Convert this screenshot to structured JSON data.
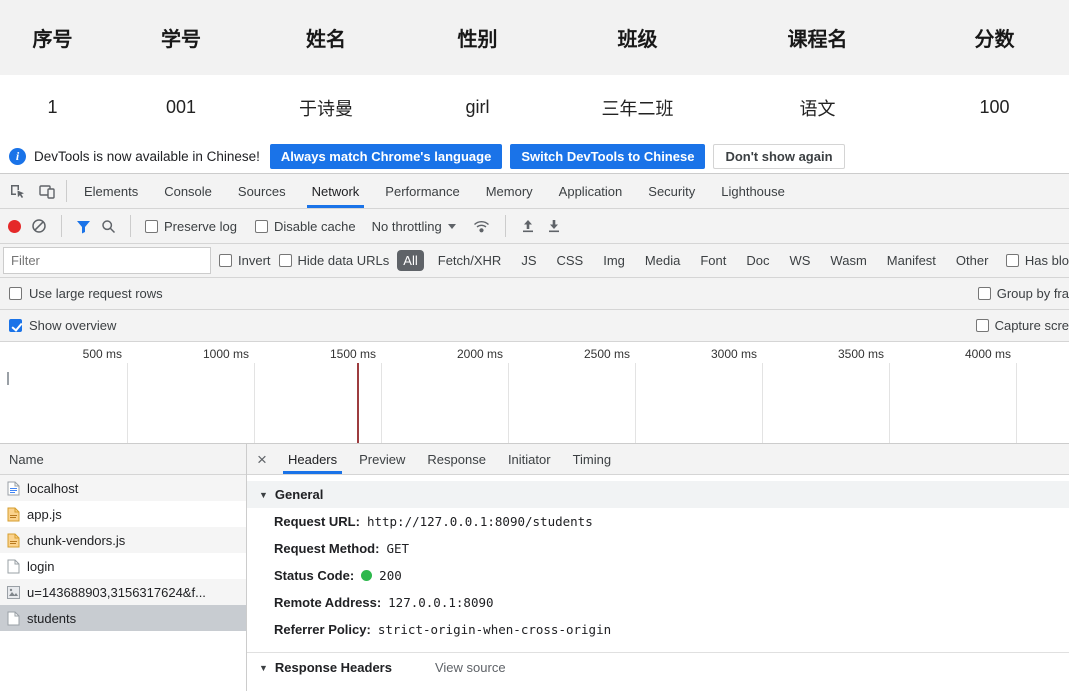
{
  "student_table": {
    "headers": [
      "序号",
      "学号",
      "姓名",
      "性别",
      "班级",
      "课程名",
      "分数"
    ],
    "row": [
      "1",
      "001",
      "于诗曼",
      "girl",
      "三年二班",
      "语文",
      "100"
    ]
  },
  "notification": {
    "message": "DevTools is now available in Chinese!",
    "match_language_button": "Always match Chrome's language",
    "switch_button": "Switch DevTools to Chinese",
    "dismiss_button": "Don't show again"
  },
  "devtools": {
    "accent_color": "#1a73e8",
    "main_tabs": [
      "Elements",
      "Console",
      "Sources",
      "Network",
      "Performance",
      "Memory",
      "Application",
      "Security",
      "Lighthouse"
    ],
    "active_main_tab": "Network",
    "toolbar": {
      "icons": [
        "inspect-icon",
        "device-toolbar-icon",
        "record-icon",
        "clear-icon",
        "filter-icon",
        "search-icon",
        "network-conditions-icon",
        "import-har-icon",
        "export-har-icon"
      ],
      "record_color": "#e52929",
      "preserve_log_label": "Preserve log",
      "disable_cache_label": "Disable cache",
      "throttling_value": "No throttling"
    },
    "filter_bar": {
      "placeholder": "Filter",
      "invert_label": "Invert",
      "hide_data_urls_label": "Hide data URLs",
      "types": [
        "All",
        "Fetch/XHR",
        "JS",
        "CSS",
        "Img",
        "Media",
        "Font",
        "Doc",
        "WS",
        "Wasm",
        "Manifest",
        "Other"
      ],
      "active_type": "All",
      "has_blocked_label": "Has blo"
    },
    "options": {
      "use_large_rows_label": "Use large request rows",
      "group_by_frame_label": "Group by fra",
      "show_overview_label": "Show overview",
      "show_overview_checked": true,
      "capture_screenshots_label": "Capture scre"
    },
    "timeline_ticks": [
      "500 ms",
      "1000 ms",
      "1500 ms",
      "2000 ms",
      "2500 ms",
      "3000 ms",
      "3500 ms",
      "4000 ms"
    ],
    "requests": {
      "name_header": "Name",
      "selected": "students",
      "items": [
        {
          "name": "localhost",
          "icon": "document-icon"
        },
        {
          "name": "app.js",
          "icon": "js-file-icon"
        },
        {
          "name": "chunk-vendors.js",
          "icon": "js-file-icon"
        },
        {
          "name": "login",
          "icon": "file-icon"
        },
        {
          "name": "u=143688903,3156317624&f...",
          "icon": "image-file-icon"
        },
        {
          "name": "students",
          "icon": "file-icon"
        }
      ]
    },
    "details": {
      "tabs": [
        "Headers",
        "Preview",
        "Response",
        "Initiator",
        "Timing"
      ],
      "active_tab": "Headers",
      "general_title": "General",
      "general": [
        {
          "key": "Request URL:",
          "value": "http://127.0.0.1:8090/students"
        },
        {
          "key": "Request Method:",
          "value": "GET"
        },
        {
          "key": "Status Code:",
          "value": "200"
        },
        {
          "key": "Remote Address:",
          "value": "127.0.0.1:8090"
        },
        {
          "key": "Referrer Policy:",
          "value": "strict-origin-when-cross-origin"
        }
      ],
      "status_dot_color": "#2db84c",
      "response_headers_title": "Response Headers",
      "view_source_label": "View source"
    }
  }
}
